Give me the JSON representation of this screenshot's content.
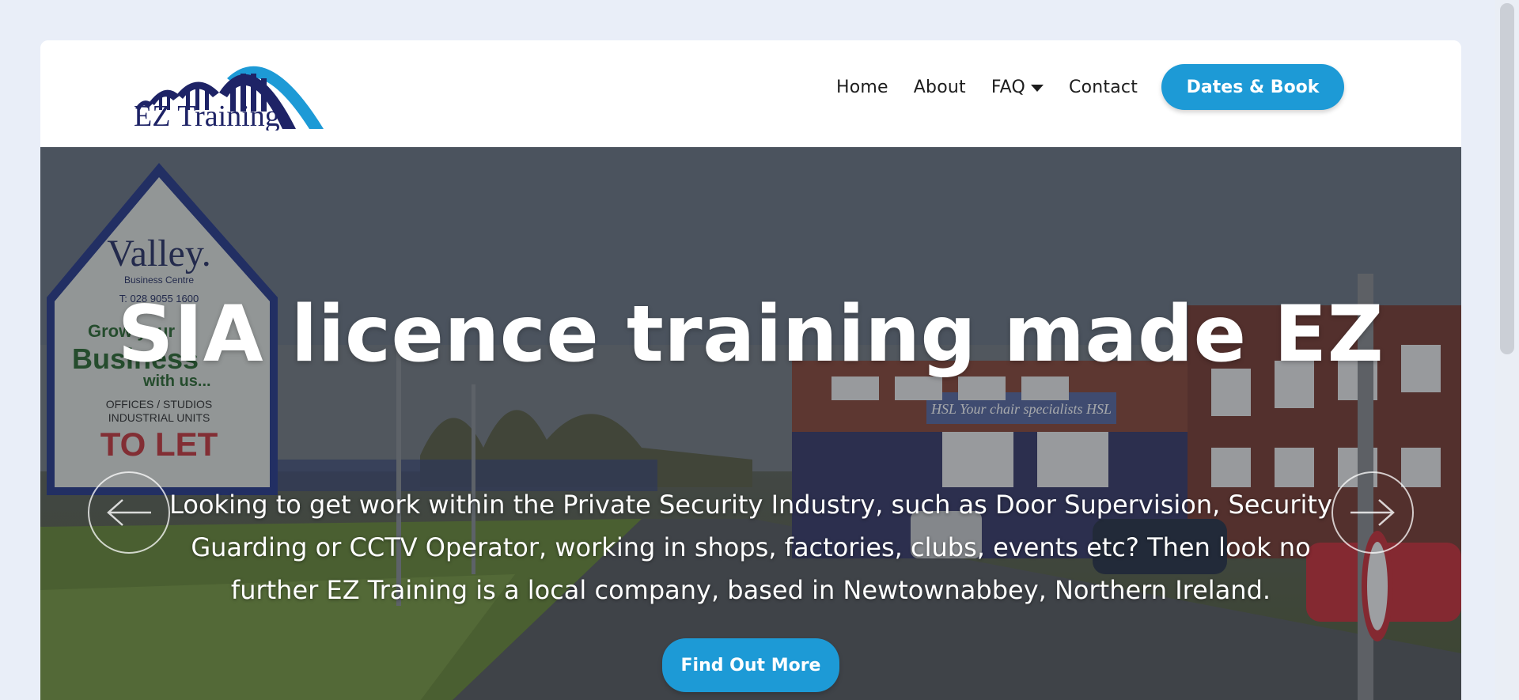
{
  "brand": {
    "logo_text": "EZ Training",
    "logo_icon": "bridge-arches-logo",
    "color_navy": "#1e2366",
    "color_blue": "#1d9ad6"
  },
  "nav": {
    "items": [
      {
        "label": "Home"
      },
      {
        "label": "About"
      },
      {
        "label": "FAQ",
        "icon": "caret-down-icon"
      },
      {
        "label": "Contact"
      }
    ],
    "cta_label": "Dates & Book"
  },
  "hero": {
    "title": "SIA licence training made EZ",
    "description": "Looking to get work within the Private Security Industry, such as Door Supervision, Security Guarding or CCTV Operator, working in shops, factories, clubs, events etc? Then look no further EZ Training is a local company, based in Newtownabbey, Northern Ireland.",
    "cta_label": "Find Out More",
    "prev_icon": "arrow-left-icon",
    "next_icon": "arrow-right-icon",
    "sign": {
      "name": "Valley.",
      "subtitle": "Business Centre",
      "phone": "T: 028 9055 1600",
      "line1": "Grow your",
      "line2": "Business",
      "line3": "with us...",
      "line4": "OFFICES / STUDIOS",
      "line5": "INDUSTRIAL UNITS",
      "line6": "TO LET"
    },
    "building_sign": "HSL Your chair specialists HSL"
  }
}
